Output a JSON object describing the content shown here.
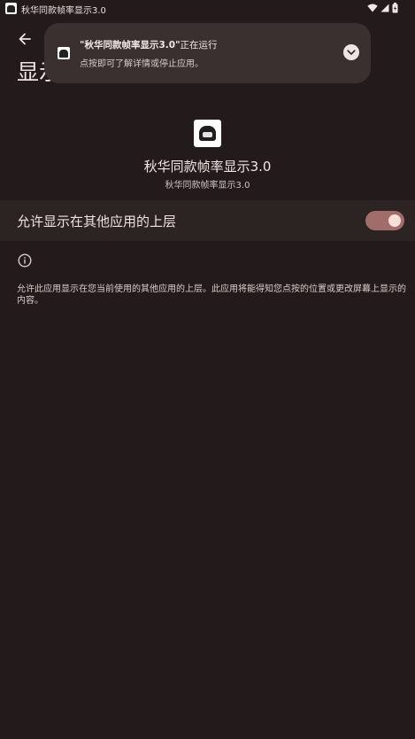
{
  "status_bar": {
    "title": "秋华同款帧率显示3.0",
    "wifi_icon": "wifi-icon",
    "signal_icon": "signal-icon",
    "battery_icon": "battery-icon"
  },
  "app_bar": {
    "back_icon": "back-arrow-icon",
    "title": "显示在其他应用的上层"
  },
  "notification": {
    "app_name_quoted": "\"秋华同款帧率显示3.0\"",
    "title_suffix": "正在运行",
    "subtitle": "点按即可了解详情或停止应用。",
    "expand_icon": "chevron-down-icon"
  },
  "app_info": {
    "name": "秋华同款帧率显示3.0",
    "version": "秋华同款帧率显示3.0"
  },
  "permission": {
    "label": "允许显示在其他应用的上层",
    "enabled": true
  },
  "info": {
    "icon": "info-icon",
    "text": "允许此应用显示在您当前使用的其他应用的上层。此应用将能得知您点按的位置或更改屏幕上显示的内容。"
  },
  "colors": {
    "background": "#231b1b",
    "notification_bg": "#3a3030",
    "row_bg": "#2c2323",
    "toggle_track": "#a06d6a",
    "toggle_knob": "#f6dedb"
  }
}
